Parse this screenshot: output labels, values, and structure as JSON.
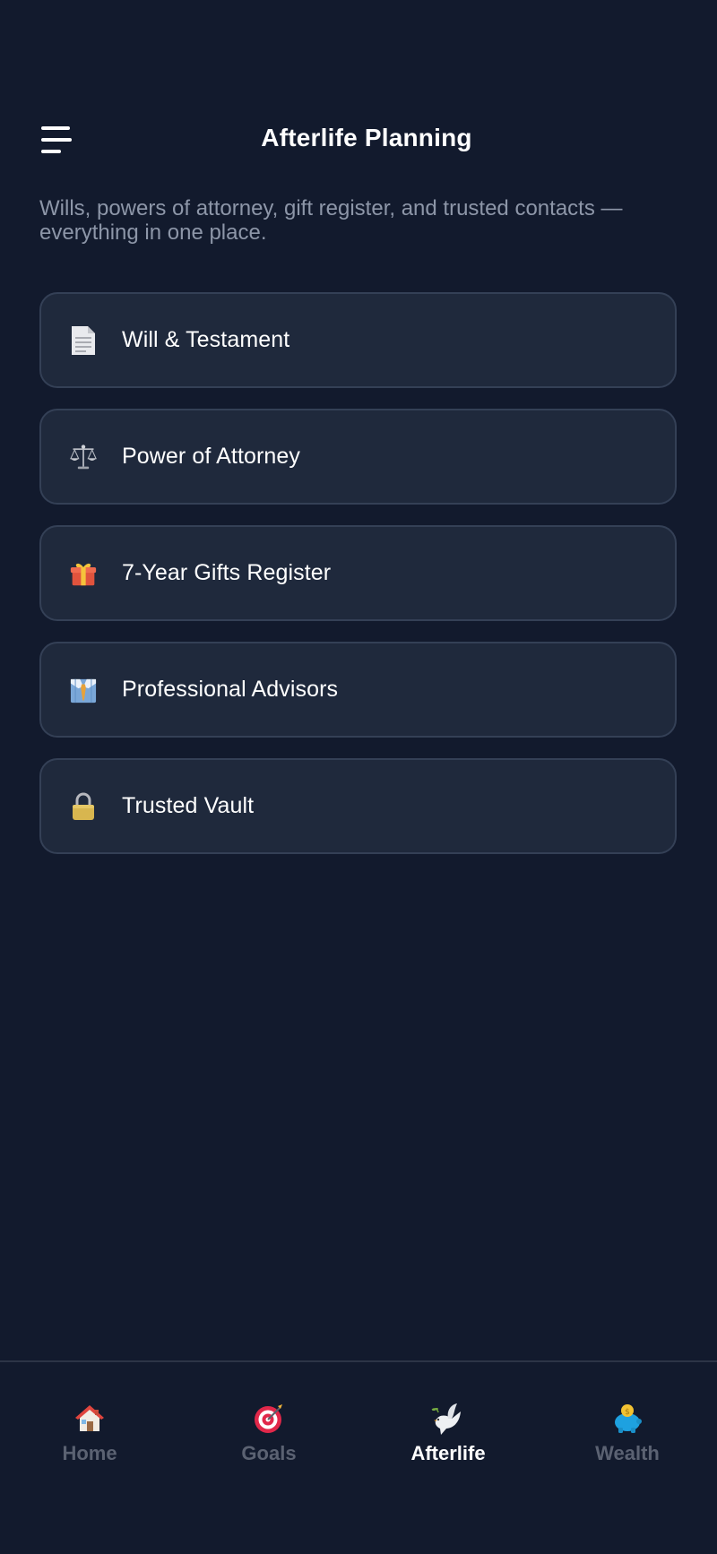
{
  "header": {
    "title": "Afterlife Planning",
    "menu_icon": "hamburger-menu-icon"
  },
  "subtitle": "Wills, powers of attorney, gift register, and trusted contacts — everything in one place.",
  "cards": [
    {
      "label": "Will & Testament",
      "icon": "document-icon"
    },
    {
      "label": "Power of Attorney",
      "icon": "scales-icon"
    },
    {
      "label": "7-Year Gifts Register",
      "icon": "gift-icon"
    },
    {
      "label": "Professional Advisors",
      "icon": "suit-tie-icon"
    },
    {
      "label": "Trusted Vault",
      "icon": "lock-icon"
    }
  ],
  "bottom_nav": {
    "items": [
      {
        "label": "Home",
        "icon": "house-icon",
        "active": false
      },
      {
        "label": "Goals",
        "icon": "target-icon",
        "active": false
      },
      {
        "label": "Afterlife",
        "icon": "dove-icon",
        "active": true
      },
      {
        "label": "Wealth",
        "icon": "piggy-bank-icon",
        "active": false
      }
    ]
  },
  "colors": {
    "background": "#121a2d",
    "card_background": "#1f293c",
    "card_border": "#344056",
    "subtitle_text": "#8d96a8",
    "nav_inactive": "#5b6272",
    "nav_active": "#ffffff"
  }
}
